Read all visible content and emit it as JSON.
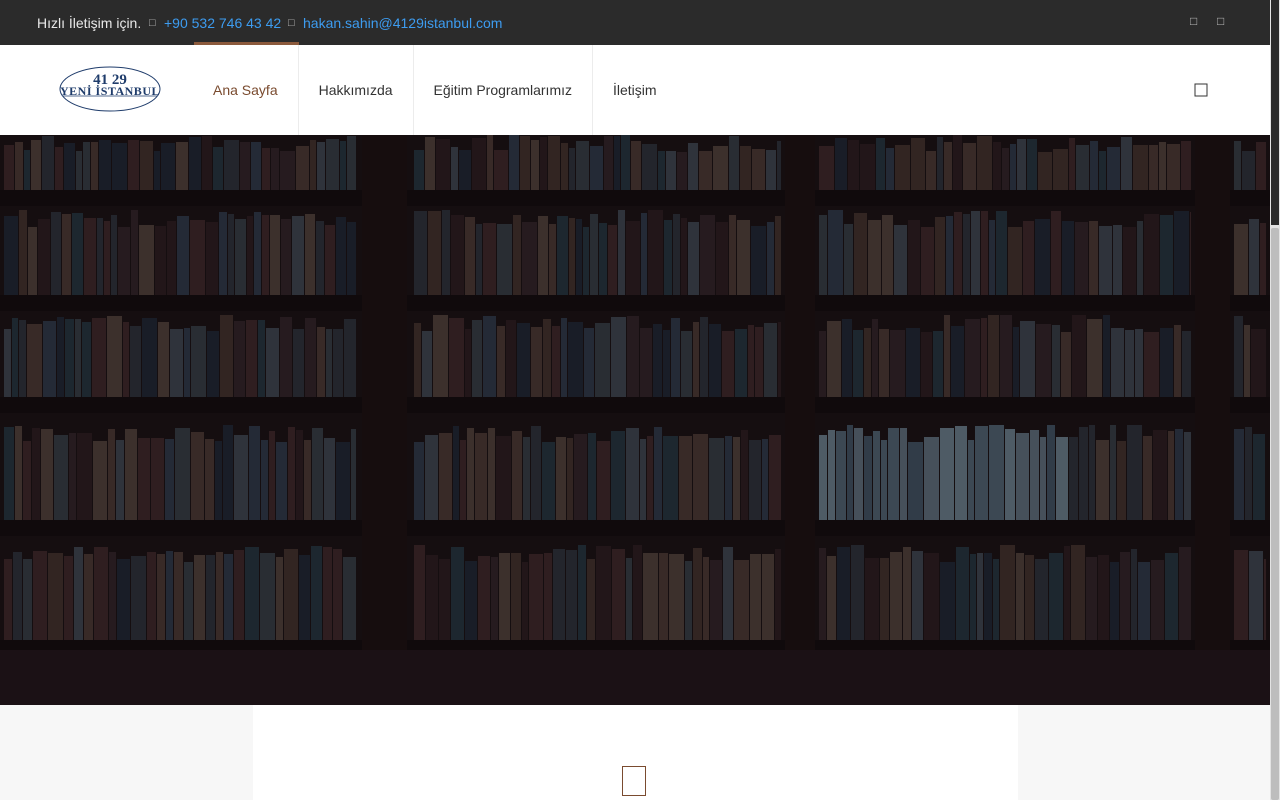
{
  "topbar": {
    "quick_contact_label": "Hızlı İletişim için.",
    "phone": "+90 532 746 43 42",
    "email": "hakan.sahin@4129istanbul.com",
    "phone_icon": "phone-icon",
    "email_icon": "envelope-icon",
    "social_icons": [
      "facebook-icon",
      "instagram-icon"
    ]
  },
  "header": {
    "logo": {
      "top_text": "41 29",
      "main_text": "YENİ İSTANBUL"
    },
    "nav": [
      {
        "label": "Ana Sayfa",
        "active": true
      },
      {
        "label": "Hakkımızda",
        "active": false
      },
      {
        "label": "Eğitim Programlarımız",
        "active": false
      },
      {
        "label": "İletişim",
        "active": false
      }
    ],
    "search_icon": "search-icon"
  },
  "colors": {
    "topbar_bg": "#2b2b2b",
    "link": "#3d9cf0",
    "accent": "#7a4b2f",
    "hero_bg": "#1d1416"
  }
}
